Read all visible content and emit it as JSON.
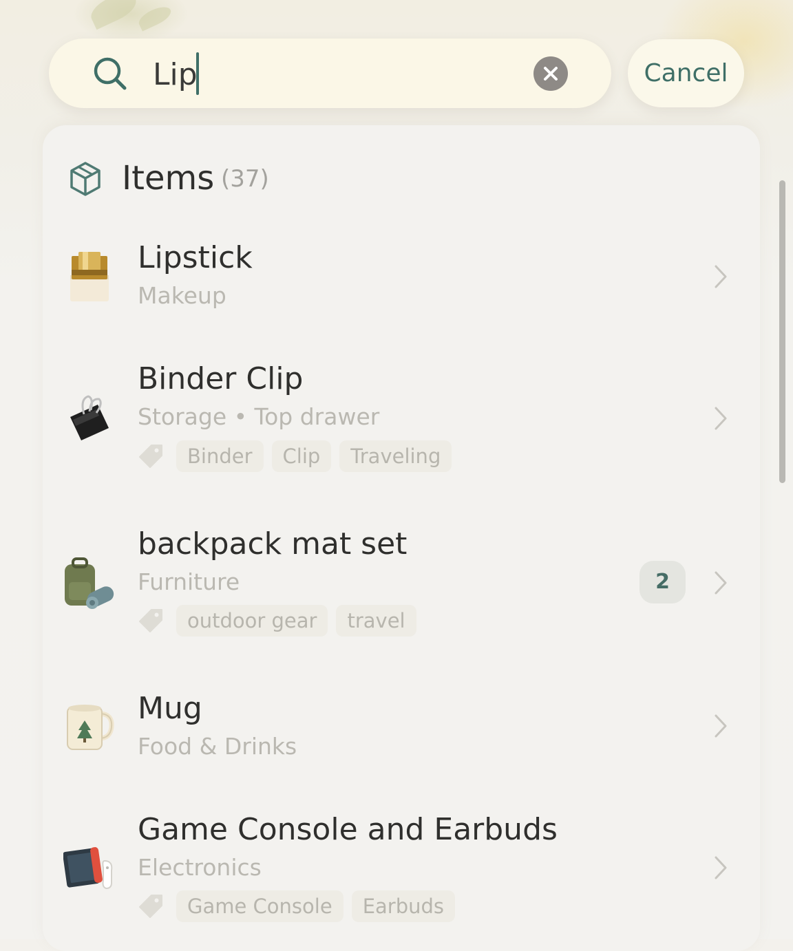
{
  "search": {
    "value": "Lip",
    "cancel_label": "Cancel"
  },
  "section": {
    "title": "Items",
    "count": "(37)"
  },
  "items": [
    {
      "title": "Lipstick",
      "subtitle": "Makeup",
      "tags": []
    },
    {
      "title": "Binder Clip",
      "subtitle": "Storage • Top drawer",
      "tags": [
        "Binder",
        "Clip",
        "Traveling"
      ]
    },
    {
      "title": "backpack mat set",
      "subtitle": "Furniture",
      "tags": [
        "outdoor gear",
        "travel"
      ],
      "badge": "2"
    },
    {
      "title": "Mug",
      "subtitle": "Food & Drinks",
      "tags": []
    },
    {
      "title": "Game Console and Earbuds",
      "subtitle": "Electronics",
      "tags": [
        "Game Console",
        "Earbuds"
      ]
    }
  ],
  "colors": {
    "accent": "#3f6f67",
    "text_primary": "#2f2f2d",
    "text_secondary": "#bab8b1",
    "tag_bg": "#eeece5"
  }
}
